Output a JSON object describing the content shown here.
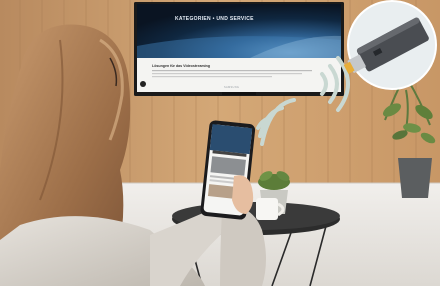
{
  "tv": {
    "hero_title": "KATEGORIEN • UND SERVICE",
    "page_heading": "Lösungen für das Videostreaming",
    "brand": "SAMSUNG"
  },
  "colors": {
    "wall_wood": "#c99a6b",
    "wifi_waves": "#c9d8d2",
    "floor": "#ece9e4",
    "tv_frame": "#1a1a1a",
    "dongle": "#4a4d52"
  },
  "icons": [
    "wifi-icon",
    "hdmi-dongle",
    "smartphone"
  ]
}
